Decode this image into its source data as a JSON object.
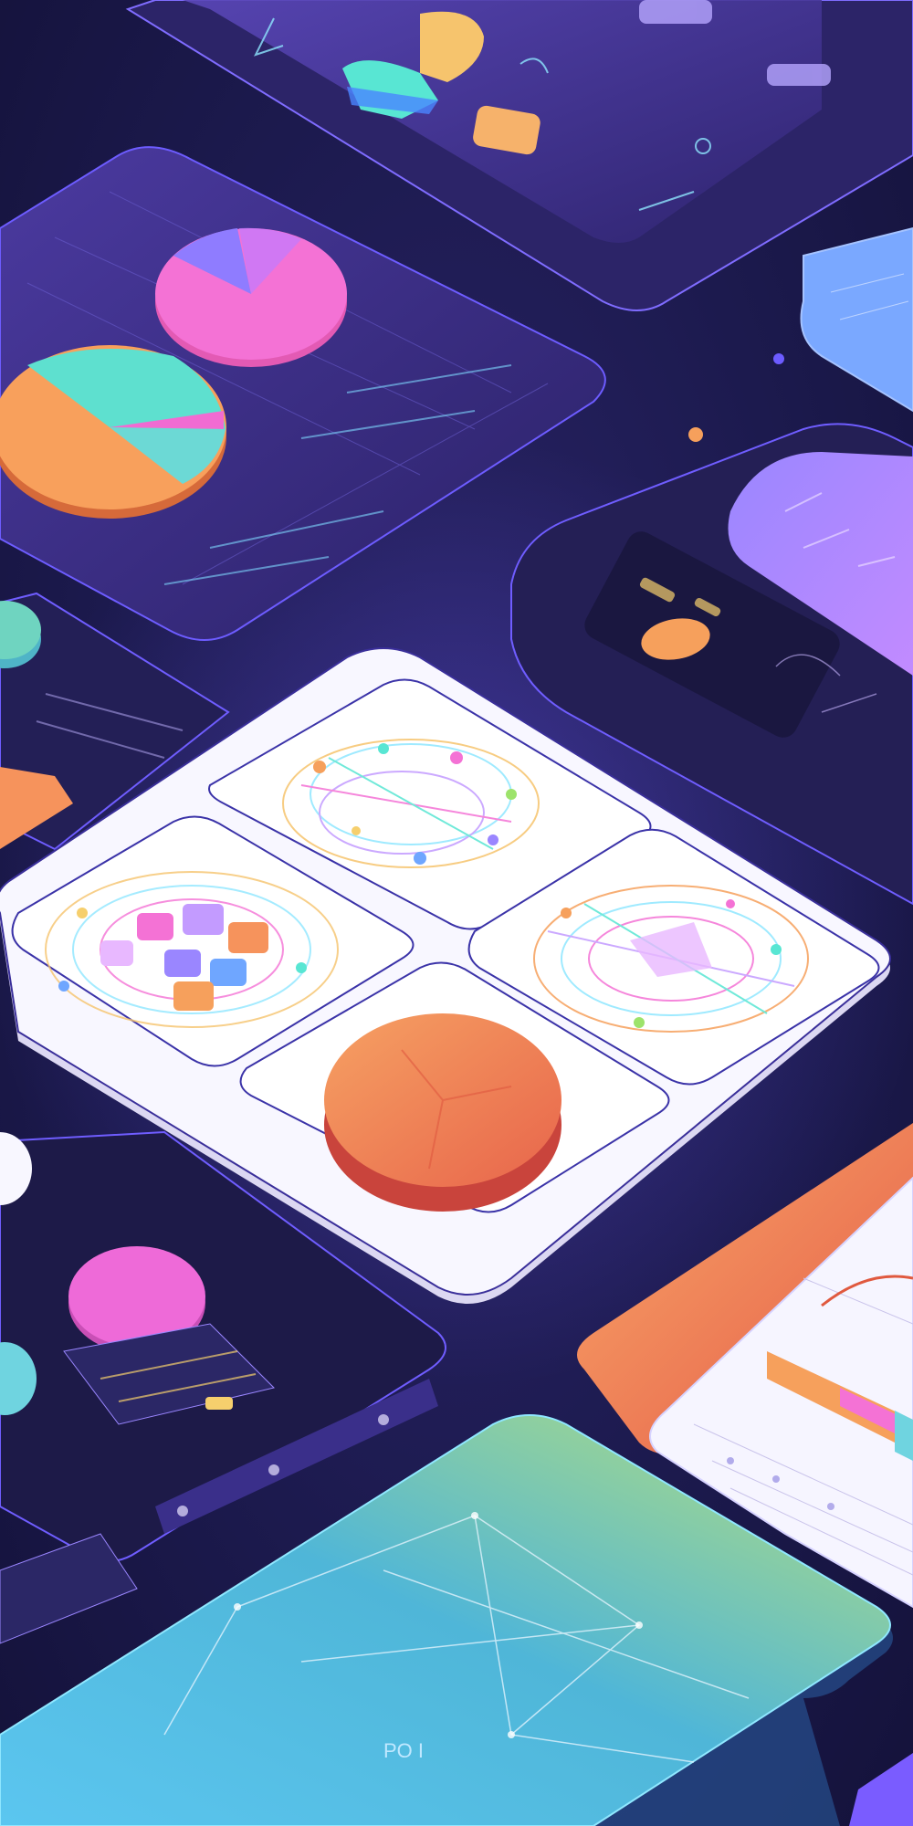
{
  "scene": {
    "description_visible_text": "",
    "colors": {
      "background": "#1c1a4e",
      "panel_dark": "#2c2466",
      "panel_purple": "#3b2b86",
      "panel_light": "#f6f5ff",
      "accent_orange": "#f59a5c",
      "accent_pink": "#f16bd2",
      "accent_teal": "#58e6d3",
      "accent_blue": "#6fa6ff",
      "accent_yellow": "#f6cf6d",
      "accent_green": "#9de36b"
    },
    "labels": {
      "bottom_panel_label": "PO I"
    }
  }
}
